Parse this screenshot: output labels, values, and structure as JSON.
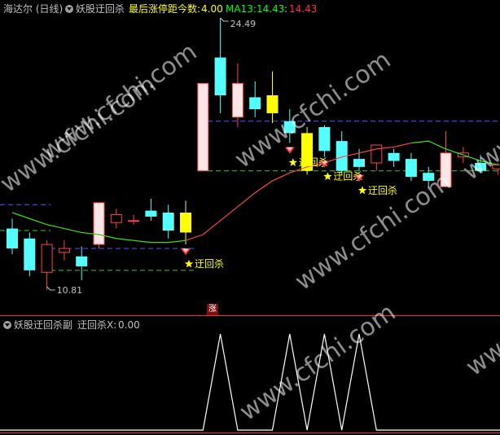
{
  "header": {
    "title": "海达尔 (日线)",
    "indicator_name": "妖股迂回杀",
    "last_limit_label": "最后涨停距今数: ",
    "last_limit_value": "4.00",
    "ma_label": "MA13: ",
    "ma_value": "14.43",
    "ma_value2": "14.43"
  },
  "chart": {
    "high_label": "24.49",
    "low_label": "10.81",
    "signal_text": "迂回杀",
    "limit_up_badge": "涨"
  },
  "sub_header": {
    "indicator_name": "妖股迂回杀副",
    "value_label": "迂回杀X: ",
    "value": "0.00"
  },
  "watermark": "www.cfchi.com",
  "colors": {
    "up": "#ff4444",
    "down": "#54ffff",
    "yellow": "#ffff00",
    "ma": "#00ff00",
    "panel_border": "#ff2a2a"
  },
  "chart_data": [
    {
      "type": "candlestick",
      "title": "海达尔 (日线)",
      "candles": [
        {
          "o": 13.9,
          "h": 14.4,
          "c": 12.9,
          "l": 12.6
        },
        {
          "o": 13.4,
          "h": 13.7,
          "c": 11.8,
          "l": 11.5
        },
        {
          "o": 11.7,
          "h": 13.3,
          "c": 13.1,
          "l": 10.81
        },
        {
          "o": 12.7,
          "h": 13.3,
          "c": 12.9,
          "l": 12.3
        },
        {
          "o": 12.5,
          "h": 13.0,
          "c": 12.0,
          "l": 11.3
        },
        {
          "o": 13.1,
          "h": 14.6,
          "c": 15.2,
          "l": 12.9
        },
        {
          "o": 14.2,
          "h": 14.9,
          "c": 14.6,
          "l": 13.9
        },
        {
          "o": 14.3,
          "h": 14.6,
          "c": 14.3,
          "l": 14.1
        },
        {
          "o": 14.8,
          "h": 15.4,
          "c": 14.5,
          "l": 14.3
        },
        {
          "o": 14.7,
          "h": 15.1,
          "c": 13.8,
          "l": 13.4
        },
        {
          "o": 14.7,
          "h": 15.3,
          "c": 13.7,
          "l": 13.1
        },
        {
          "o": 16.8,
          "h": 21.0,
          "c": 21.2,
          "l": 16.8
        },
        {
          "o": 22.5,
          "h": 24.49,
          "c": 20.6,
          "l": 19.7
        },
        {
          "o": 19.5,
          "h": 22.2,
          "c": 21.2,
          "l": 19.0
        },
        {
          "o": 20.5,
          "h": 21.3,
          "c": 19.9,
          "l": 19.5
        },
        {
          "o": 20.6,
          "h": 21.8,
          "c": 19.7,
          "l": 19.2
        },
        {
          "o": 19.3,
          "h": 19.9,
          "c": 18.7,
          "l": 18.2
        },
        {
          "o": 18.7,
          "h": 19.0,
          "c": 16.8,
          "l": 16.6
        },
        {
          "o": 19.0,
          "h": 19.1,
          "c": 17.8,
          "l": 17.5
        },
        {
          "o": 18.3,
          "h": 18.8,
          "c": 16.8,
          "l": 16.6
        },
        {
          "o": 17.4,
          "h": 17.9,
          "c": 17.0,
          "l": 16.8
        },
        {
          "o": 17.2,
          "h": 18.0,
          "c": 18.1,
          "l": 16.8
        },
        {
          "o": 17.7,
          "h": 17.9,
          "c": 17.3,
          "l": 17.0
        },
        {
          "o": 17.4,
          "h": 17.7,
          "c": 16.5,
          "l": 16.3
        },
        {
          "o": 16.7,
          "h": 17.0,
          "c": 16.3,
          "l": 16.0
        },
        {
          "o": 16.0,
          "h": 18.8,
          "c": 17.7,
          "l": 16.0
        },
        {
          "o": 17.5,
          "h": 18.0,
          "c": 17.7,
          "l": 17.2
        },
        {
          "o": 17.2,
          "h": 17.6,
          "c": 16.8,
          "l": 16.7
        },
        {
          "o": 16.9,
          "h": 17.2,
          "c": 17.1,
          "l": 16.6
        }
      ],
      "ma13": [
        14.7,
        14.4,
        14.1,
        13.9,
        13.7,
        13.6,
        13.4,
        13.3,
        13.2,
        13.2,
        13.3,
        13.6,
        14.3,
        15.0,
        15.7,
        16.3,
        16.7,
        17.0,
        17.2,
        17.5,
        17.7,
        17.9,
        18.0,
        18.2,
        18.3,
        17.9,
        17.6,
        17.3,
        17.1
      ],
      "signal_markers": [
        {
          "index": 10,
          "label": "迂回杀"
        },
        {
          "index": 16,
          "label": "迂回杀"
        },
        {
          "index": 18,
          "label": "迂回杀"
        },
        {
          "index": 20,
          "label": "迂回杀"
        }
      ]
    },
    {
      "type": "line",
      "title": "妖股迂回杀副",
      "series": [
        {
          "name": "迂回杀X",
          "values": [
            0,
            0,
            0,
            0,
            0,
            0,
            0,
            0,
            0,
            0,
            0,
            0,
            1,
            0,
            0,
            0,
            1,
            0,
            1,
            0,
            1,
            0,
            0,
            0,
            0,
            0,
            0,
            0,
            0
          ]
        }
      ]
    }
  ]
}
